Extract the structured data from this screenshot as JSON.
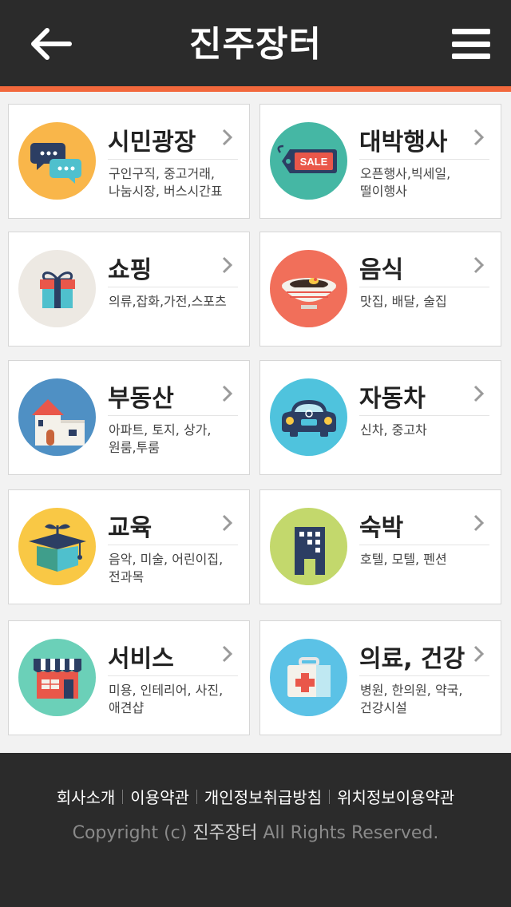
{
  "header": {
    "title": "진주장터",
    "back_icon": "arrow-left-icon",
    "menu_icon": "hamburger-menu-icon",
    "background": "#2b2b2b",
    "accent": "#f2683c"
  },
  "categories": [
    {
      "name": "시민광장",
      "desc": "구인구직, 중고거래,\n나눔시장, 버스시간표",
      "icon": "speech-bubbles-icon",
      "color": "#f9b64a"
    },
    {
      "name": "대박행사",
      "desc": "오픈행사,빅세일,\n떨이행사",
      "icon": "sale-tag-icon",
      "color": "#45b7a4",
      "tag_text": "SALE"
    },
    {
      "name": "쇼핑",
      "desc": "의류,잡화,가전,스포츠",
      "icon": "gift-box-icon",
      "color": "#ede9e3"
    },
    {
      "name": "음식",
      "desc": "맛집, 배달, 술집",
      "icon": "noodle-bowl-icon",
      "color": "#f16f5a"
    },
    {
      "name": "부동산",
      "desc": "아파트, 토지, 상가,\n원룸,투룸",
      "icon": "house-icon",
      "color": "#4f90c4"
    },
    {
      "name": "자동차",
      "desc": "신차, 중고차",
      "icon": "car-icon",
      "color": "#4fc3dd"
    },
    {
      "name": "교육",
      "desc": "음악, 미술, 어린이집,\n전과목",
      "icon": "graduation-box-icon",
      "color": "#f9c845"
    },
    {
      "name": "숙박",
      "desc": "호텔, 모텔, 펜션",
      "icon": "building-icon",
      "color": "#c3d86c"
    },
    {
      "name": "서비스",
      "desc": "미용, 인테리어, 사진,\n애견샵",
      "icon": "shop-icon",
      "color": "#6bd0b8"
    },
    {
      "name": "의료, 건강",
      "desc": "병원, 한의원, 약국,\n건강시설",
      "icon": "first-aid-kit-icon",
      "color": "#5bc2e6"
    }
  ],
  "footer": {
    "links": [
      "회사소개",
      "이용약관",
      "개인정보취급방침",
      "위치정보이용약관"
    ],
    "copyright_prefix": "Copyright (c)",
    "copyright_brand": "진주장터",
    "copyright_suffix": "All Rights Reserved."
  }
}
